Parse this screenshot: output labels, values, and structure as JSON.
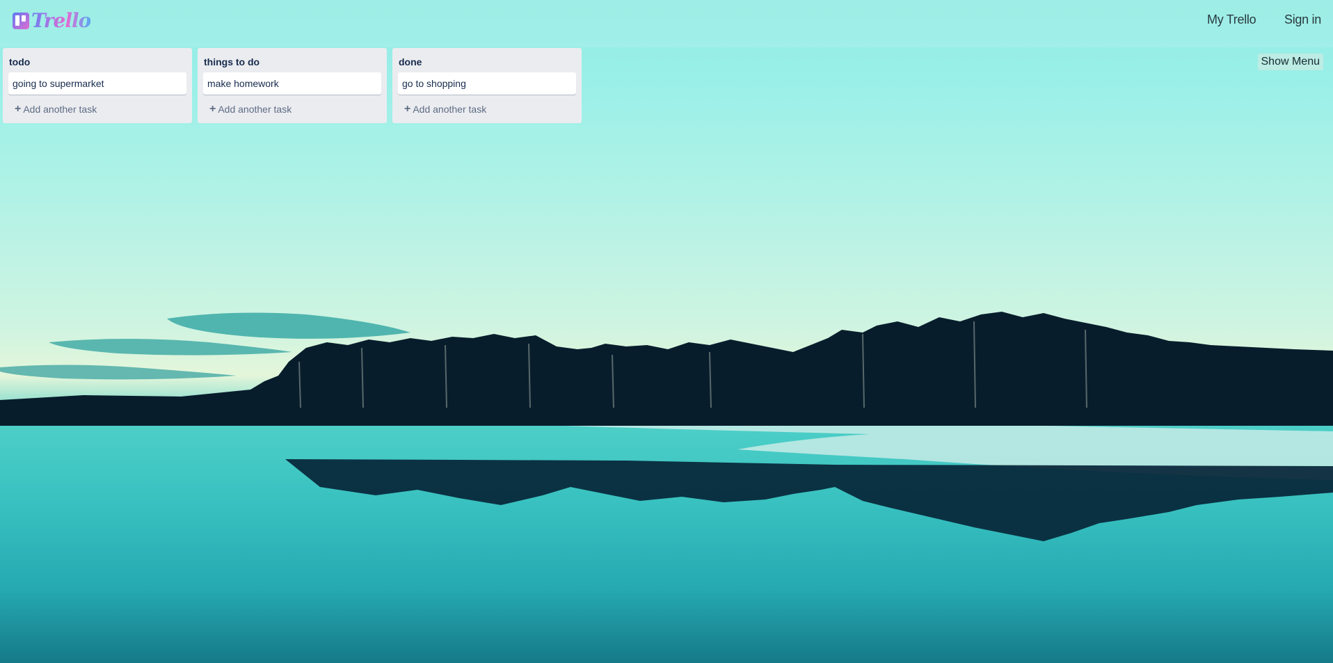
{
  "header": {
    "logo_text": "Trello",
    "nav": [
      {
        "label": "My Trello"
      },
      {
        "label": "Sign in"
      }
    ]
  },
  "board": {
    "menu_button": "Show Menu",
    "lists": [
      {
        "title": "todo",
        "cards": [
          "going to supermarket"
        ],
        "add_label": "Add another task"
      },
      {
        "title": "things to do",
        "cards": [
          "make homework"
        ],
        "add_label": "Add another task"
      },
      {
        "title": "done",
        "cards": [
          "go to shopping"
        ],
        "add_label": "Add another task"
      }
    ]
  },
  "icons": {
    "logo": "trello-board-icon",
    "add": "plus-icon"
  },
  "colors": {
    "list_bg": "#ebecf0",
    "card_bg": "#ffffff",
    "text": "#172b4d",
    "muted": "#5e6c84"
  }
}
